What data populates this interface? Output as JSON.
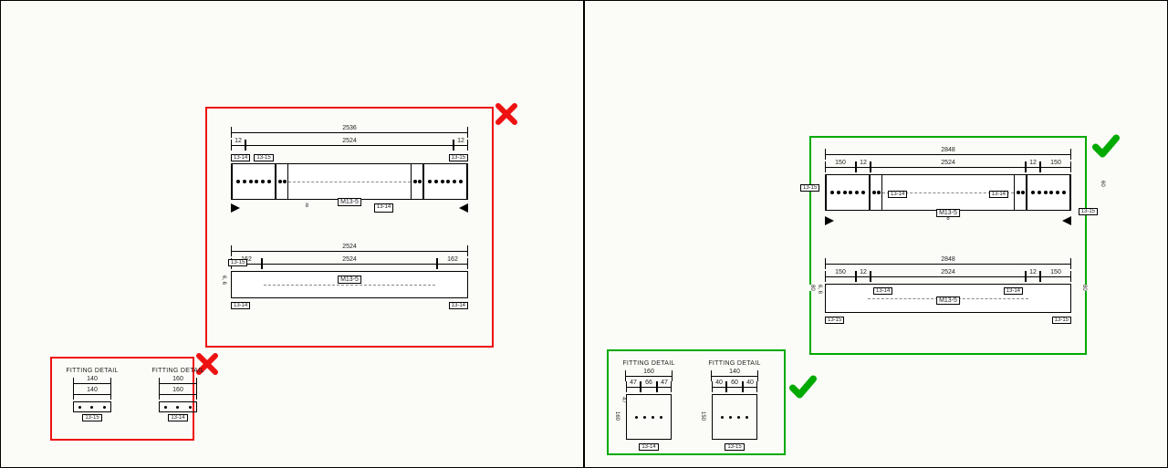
{
  "status_icons": {
    "cross": "✖",
    "check": "✔"
  },
  "left": {
    "main": {
      "top": {
        "overall": "2536",
        "sub": [
          "12",
          "2524",
          "12"
        ],
        "tags": {
          "t1": "13-14",
          "t2": "13-15",
          "t3": "13-15",
          "t4": "13-14"
        },
        "mid": "M13-5",
        "sec": "8"
      },
      "bottom": {
        "overall": "2524",
        "sub": [
          "162",
          "2524",
          "162"
        ],
        "mid": "M13-5",
        "tags": {
          "l": "13-15",
          "lb": "13-14",
          "rb": "13-14"
        },
        "axis": "6, 6"
      }
    },
    "fitting": {
      "title": "FITTING DETAIL",
      "a": {
        "w1": "140",
        "w2": "140",
        "tag": "13-15"
      },
      "b": {
        "w1": "160",
        "w2": "160",
        "tag": "13-14"
      }
    }
  },
  "right": {
    "main": {
      "top": {
        "overall": "2848",
        "sub": [
          "150",
          "12",
          "2524",
          "12",
          "150"
        ],
        "tags": {
          "t1": "13-15",
          "t2": "13-14",
          "t3": "13-14",
          "t4": "13-15"
        },
        "mid": "M13-5",
        "sec": "8",
        "v": "60"
      },
      "bottom": {
        "overall": "2848",
        "sub": [
          "150",
          "12",
          "2524",
          "12",
          "150"
        ],
        "tags": {
          "l": "13-15",
          "l2": "13-14",
          "r2": "13-14",
          "r": "13-15"
        },
        "mid": "M13-5",
        "axis": "6, 6",
        "v1": "80",
        "v2": "80"
      }
    },
    "fitting": {
      "title": "FITTING DETAIL",
      "a": {
        "wtop": "160",
        "wa": "47",
        "wb": "66",
        "wc": "47",
        "h": "160",
        "ha": "47",
        "tag": "13-14"
      },
      "b": {
        "wtop": "140",
        "wa": "40",
        "wb": "60",
        "wc": "40",
        "h": "150",
        "tag": "13-15"
      }
    }
  }
}
